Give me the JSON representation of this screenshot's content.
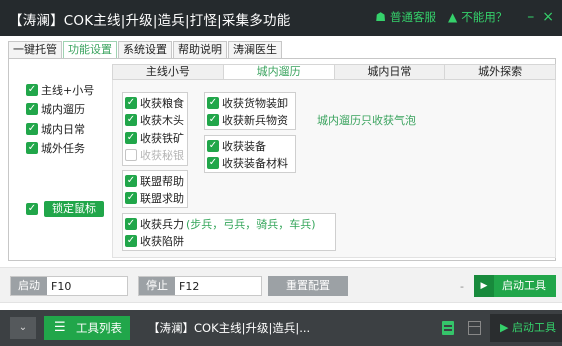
{
  "window": {
    "title": "【涛澜】COK主线|升级|造兵|打怪|采集多功能",
    "support_label": "普通客服",
    "help_label": "不能用？",
    "minimize": "–",
    "close": "×"
  },
  "main_tabs": [
    "一键托管",
    "功能设置",
    "系统设置",
    "帮助说明",
    "涛澜医生"
  ],
  "left_options": [
    {
      "label": "主线+小号",
      "checked": true
    },
    {
      "label": "城内遛历",
      "checked": true
    },
    {
      "label": "城内日常",
      "checked": true
    },
    {
      "label": "城外任务",
      "checked": true
    }
  ],
  "lock_mouse": {
    "checked": true,
    "label": "锁定鼠标"
  },
  "sub_tabs": [
    "主线小号",
    "城内遛历",
    "城内日常",
    "城外探索"
  ],
  "group_collect": [
    {
      "label": "收获粮食",
      "checked": true,
      "disabled": false
    },
    {
      "label": "收获木头",
      "checked": true,
      "disabled": false
    },
    {
      "label": "收获铁矿",
      "checked": true,
      "disabled": false
    },
    {
      "label": "收获秘银",
      "checked": false,
      "disabled": true
    }
  ],
  "group_goods": [
    {
      "label": "收获货物装卸",
      "checked": true
    },
    {
      "label": "收获新兵物资",
      "checked": true
    }
  ],
  "group_equip": [
    {
      "label": "收获装备",
      "checked": true
    },
    {
      "label": "收获装备材料",
      "checked": true
    }
  ],
  "group_alliance": [
    {
      "label": "联盟帮助",
      "checked": true
    },
    {
      "label": "联盟求助",
      "checked": true
    }
  ],
  "group_troops": [
    {
      "label": "收获兵力",
      "detail": "(步兵，弓兵，骑兵，车兵)",
      "checked": true
    },
    {
      "label": "收获陷阱",
      "checked": true
    }
  ],
  "note": "城内遛历只收获气泡",
  "controls": {
    "start_label": "启动",
    "start_key": "F10",
    "stop_label": "停止",
    "stop_key": "F12",
    "reset_label": "重置配置",
    "dash": "-",
    "start_tool_label": "启动工具"
  },
  "taskbar": {
    "tool_list_label": "工具列表",
    "current_title": "【涛澜】COK主线|升级|造兵|...",
    "start_tool_label": "启动工具"
  },
  "colors": {
    "accent": "#21a64a",
    "titlebar": "#252a2d",
    "taskbar": "#3c4043",
    "gray_button": "#9ca1a5"
  }
}
